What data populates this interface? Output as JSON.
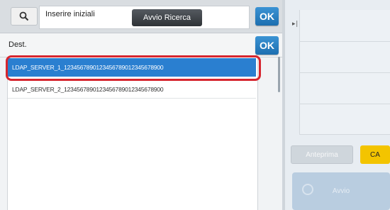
{
  "search": {
    "label": "Inserire iniziali",
    "start_label": "Avvio Ricerca",
    "ok_label": "OK"
  },
  "destination": {
    "label": "Dest.",
    "ok_label": "OK"
  },
  "list": {
    "items": [
      {
        "label": "LDAP_SERVER_1_1234567890123456789012345678900",
        "selected": true
      },
      {
        "label": "LDAP_SERVER_2_1234567890123456789012345678900",
        "selected": false
      }
    ]
  },
  "right_panel": {
    "preview_label": "Anteprima",
    "ca_label": "CA",
    "start_label": "Avvio"
  },
  "colors": {
    "accent_blue": "#2a7fd0",
    "highlight_red": "#d6262f",
    "ca_yellow": "#f3c400"
  }
}
